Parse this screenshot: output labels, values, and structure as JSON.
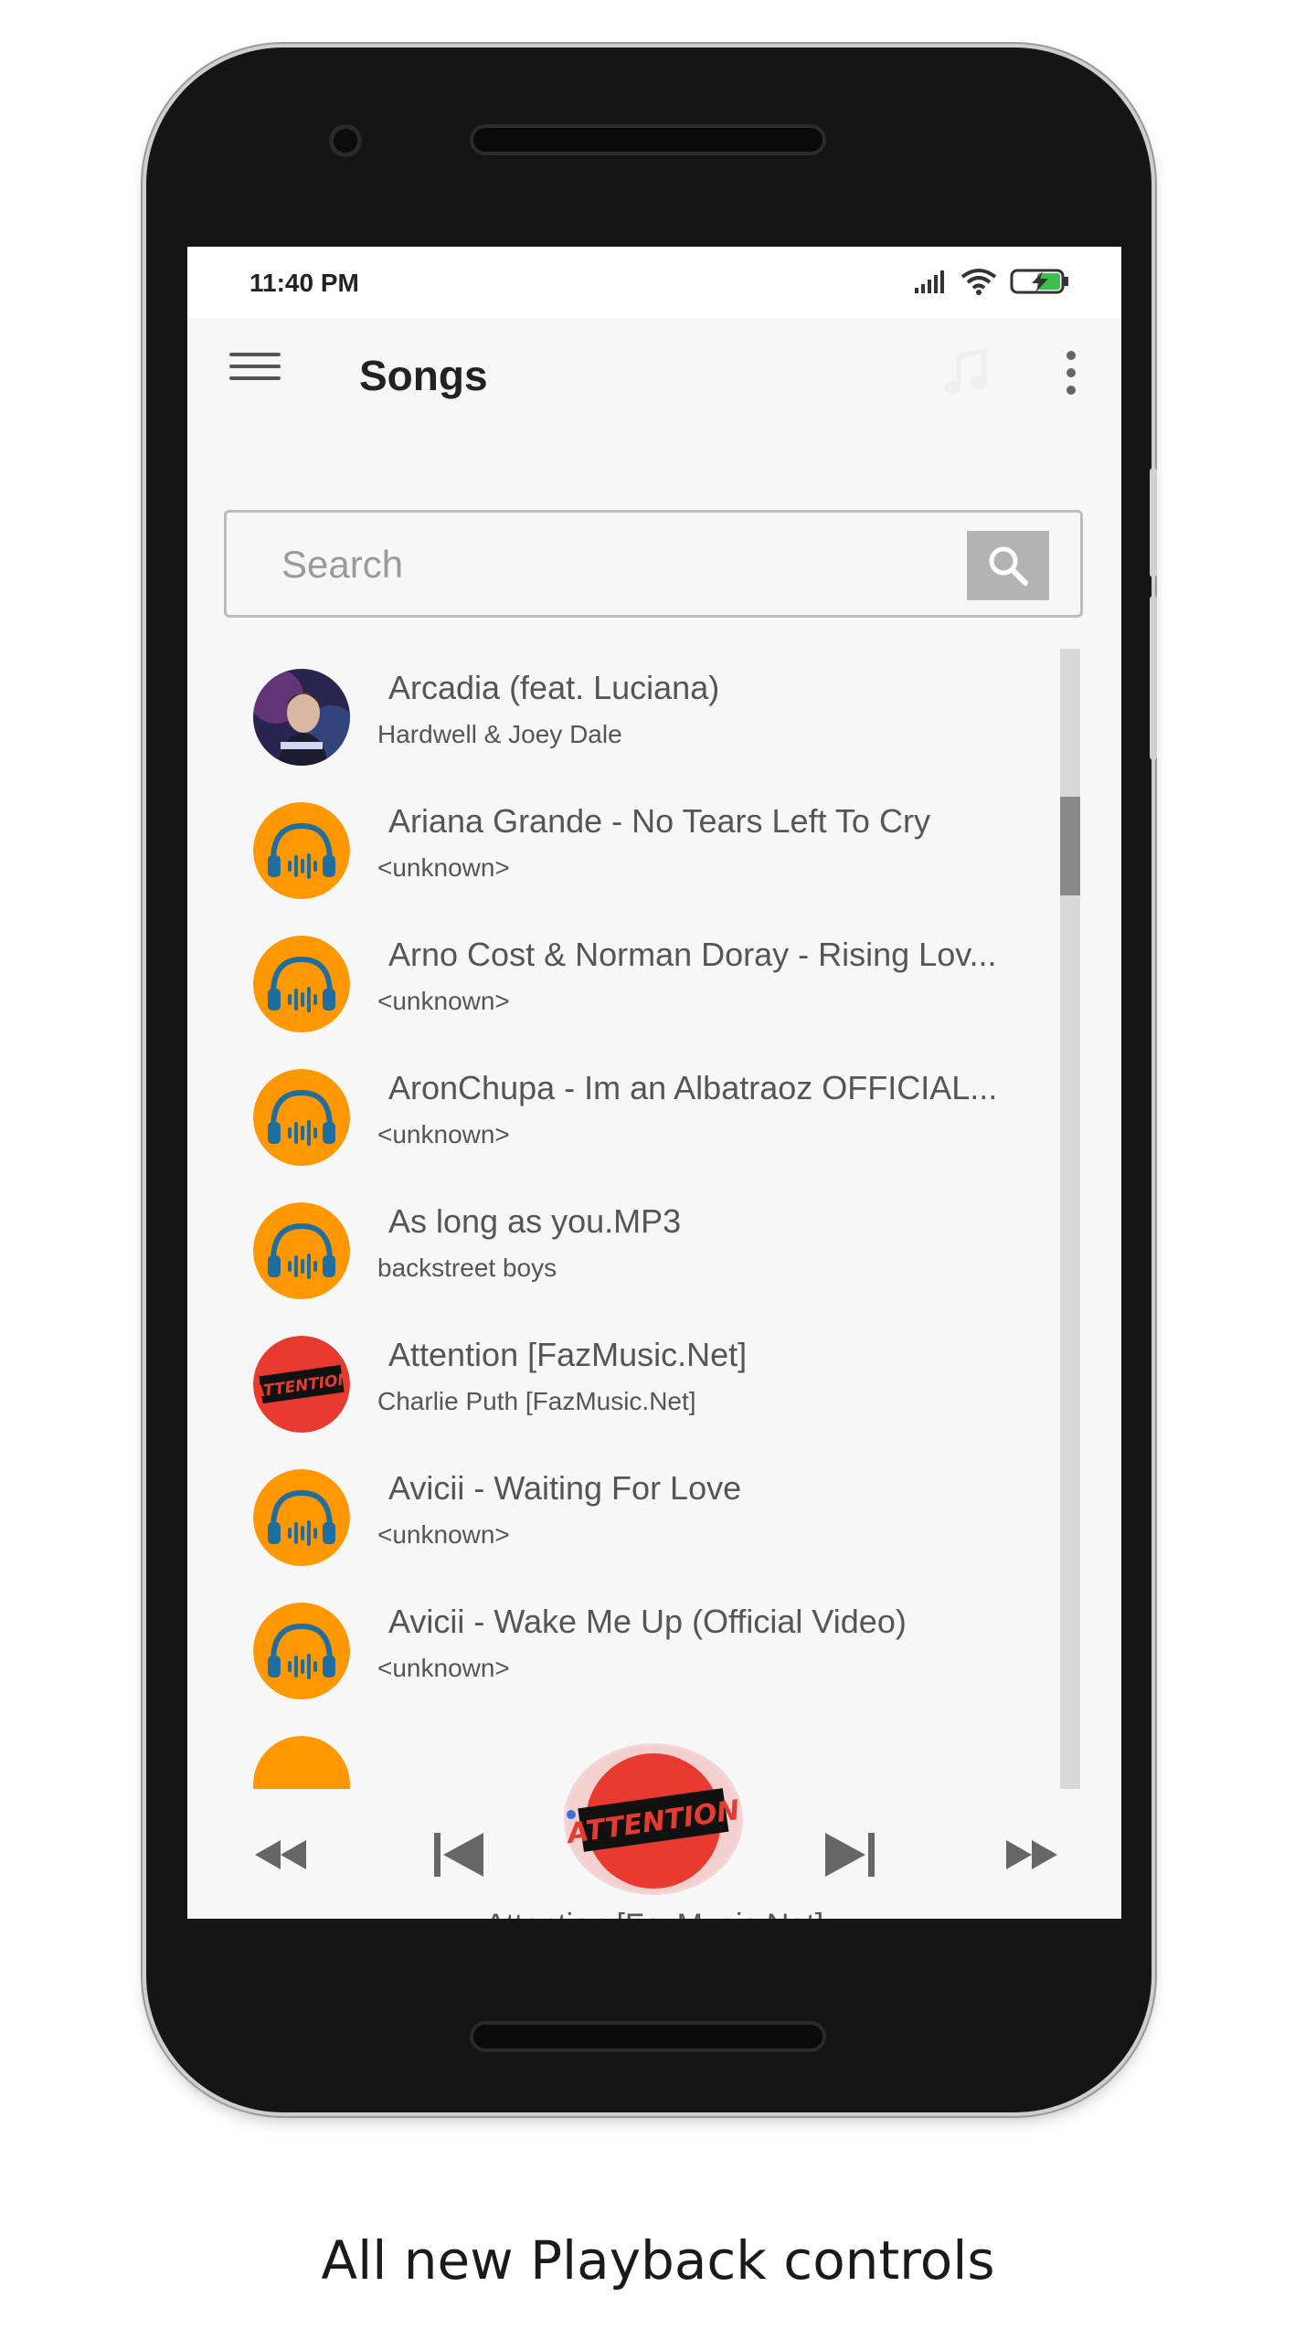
{
  "status_bar": {
    "time": "11:40 PM"
  },
  "app_bar": {
    "title": "Songs"
  },
  "search": {
    "placeholder": "Search"
  },
  "songs": [
    {
      "title": "Arcadia (feat. Luciana)",
      "artist": "Hardwell & Joey Dale",
      "art": "album-photo"
    },
    {
      "title": "Ariana Grande - No Tears Left To Cry",
      "artist": "<unknown>",
      "art": "headphones"
    },
    {
      "title": "Arno Cost & Norman Doray - Rising Lov...",
      "artist": "<unknown>",
      "art": "headphones"
    },
    {
      "title": "AronChupa - Im an Albatraoz  OFFICIAL...",
      "artist": "<unknown>",
      "art": "headphones"
    },
    {
      "title": "As long as you.MP3",
      "artist": "backstreet boys",
      "art": "headphones"
    },
    {
      "title": "Attention [FazMusic.Net]",
      "artist": "Charlie Puth [FazMusic.Net]",
      "art": "attention-cover"
    },
    {
      "title": "Avicii - Waiting For Love",
      "artist": "<unknown>",
      "art": "headphones"
    },
    {
      "title": "Avicii - Wake Me Up (Official Video)",
      "artist": "<unknown>",
      "art": "headphones"
    }
  ],
  "player": {
    "now_playing": "Attention [FazMusic.Net]",
    "controls": [
      "rewind-icon",
      "skip-previous-icon",
      "skip-next-icon",
      "fast-forward-icon"
    ]
  },
  "caption": "All new Playback controls",
  "colors": {
    "accent_orange": "#ff9800",
    "headphone_blue": "#1e6fa0",
    "attention_red": "#e83a2e"
  }
}
